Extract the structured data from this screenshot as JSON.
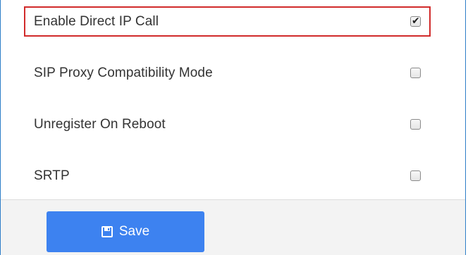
{
  "settings": {
    "items": [
      {
        "label": "Enable Direct IP Call",
        "checked": true
      },
      {
        "label": "SIP Proxy Compatibility Mode",
        "checked": false
      },
      {
        "label": "Unregister On Reboot",
        "checked": false
      },
      {
        "label": "SRTP",
        "checked": false
      }
    ]
  },
  "footer": {
    "save_label": "Save",
    "save_icon": "floppy-disk-icon"
  },
  "colors": {
    "highlight_border": "#d12b2b",
    "save_button": "#3d82f0",
    "frame_border": "#2e7ec8",
    "footer_background": "#f3f3f3"
  }
}
